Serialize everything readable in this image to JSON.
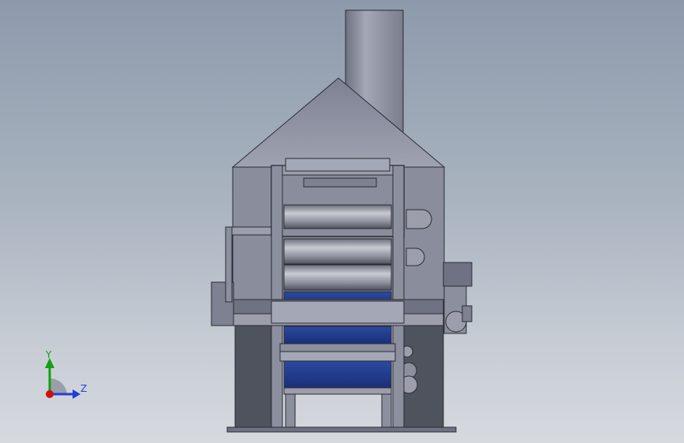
{
  "triad": {
    "y_label": "Y",
    "z_label": "Z",
    "colors": {
      "y": "#11a011",
      "z": "#1f3fd8",
      "x": "#d01010"
    }
  },
  "colors": {
    "background_top": "#8d9aab",
    "background_bottom": "#d6d9de",
    "body_light": "#9c9eac",
    "body_mid": "#7e8191",
    "body_dark": "#4f535d",
    "roller_blue": "#1f3a8a",
    "edge": "#2a2c33"
  }
}
